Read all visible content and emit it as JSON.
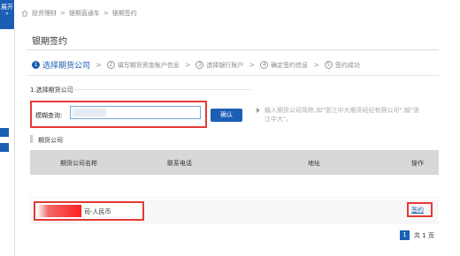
{
  "side_tab": {
    "label": "展开"
  },
  "breadcrumb": {
    "items": [
      "投资理财",
      "银期直通车",
      "银期签约"
    ],
    "separators": [
      ">",
      ">"
    ]
  },
  "page": {
    "title": "银期签约"
  },
  "steps": [
    {
      "num": "1",
      "label": "选择期货公司"
    },
    {
      "num": "2",
      "label": "填写期货资金账户信息"
    },
    {
      "num": "3",
      "label": "选择银行账户"
    },
    {
      "num": "4",
      "label": "确定签约信息"
    },
    {
      "num": "5",
      "label": "签约成功"
    }
  ],
  "step_separator": ">",
  "search": {
    "section_title": "1.选择期货公司",
    "label": "模糊查询:",
    "input_value": "",
    "confirm_label": "确认",
    "hint": "输入期货公司简称,如\"浙江中大期货经纪有限公司\",输\"浙江中大\"。"
  },
  "table": {
    "section_title": "期货公司",
    "headers": [
      "期货公司名称",
      "联系电话",
      "地址",
      "操作"
    ],
    "rows": [
      {
        "company_suffix": "司-人民币",
        "phone": "",
        "address": "",
        "action": "签约"
      }
    ]
  },
  "pager": {
    "current": "1",
    "total": "共 1 页"
  },
  "colors": {
    "primary": "#1a5fb4",
    "highlight": "#e53935"
  }
}
